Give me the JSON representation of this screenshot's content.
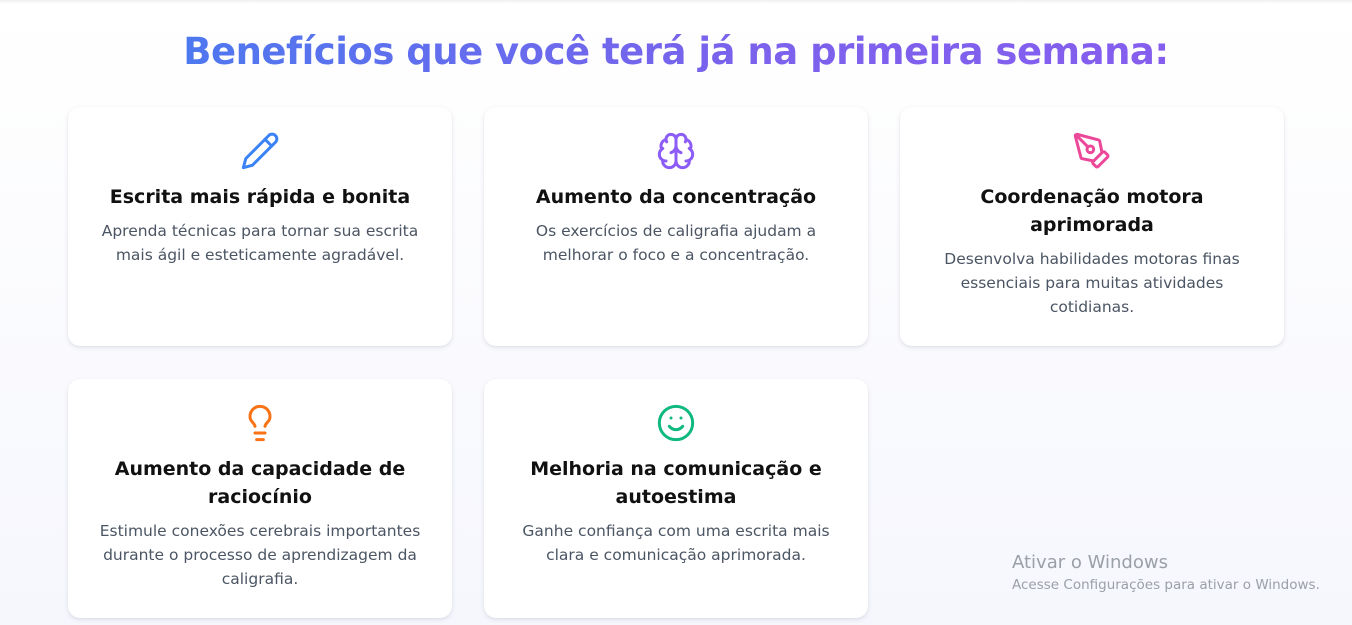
{
  "section": {
    "title": "Benefícios que você terá já na primeira semana:"
  },
  "cards": [
    {
      "icon": "pencil-icon",
      "icon_color": "#3b82f6",
      "title": "Escrita mais rápida e bonita",
      "description": "Aprenda técnicas para tornar sua escrita mais ágil e esteticamente agradável."
    },
    {
      "icon": "brain-icon",
      "icon_color": "#8b5cf6",
      "title": "Aumento da concentração",
      "description": "Os exercícios de caligrafia ajudam a melhorar o foco e a concentração."
    },
    {
      "icon": "pen-tool-icon",
      "icon_color": "#ec4899",
      "title": "Coordenação motora aprimorada",
      "description": "Desenvolva habilidades motoras finas essenciais para muitas atividades cotidianas."
    },
    {
      "icon": "lightbulb-icon",
      "icon_color": "#f97316",
      "title": "Aumento da capacidade de raciocínio",
      "description": "Estimule conexões cerebrais importantes durante o processo de aprendizagem da caligrafia."
    },
    {
      "icon": "smile-icon",
      "icon_color": "#10b981",
      "title": "Melhoria na comunicação e autoestima",
      "description": "Ganhe confiança com uma escrita mais clara e comunicação aprimorada."
    }
  ],
  "watermark": {
    "title": "Ativar o Windows",
    "subtitle": "Acesse Configurações para ativar o Windows."
  }
}
